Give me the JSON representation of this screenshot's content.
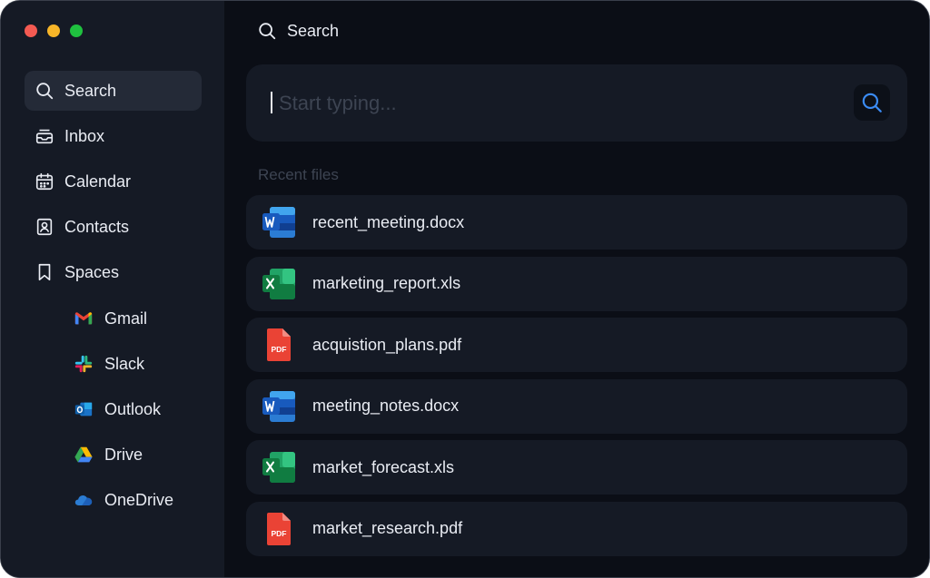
{
  "header": {
    "title": "Search"
  },
  "sidebar": {
    "nav": [
      {
        "label": "Search",
        "icon": "search-icon",
        "active": true
      },
      {
        "label": "Inbox",
        "icon": "inbox-icon"
      },
      {
        "label": "Calendar",
        "icon": "calendar-icon"
      },
      {
        "label": "Contacts",
        "icon": "contacts-icon"
      },
      {
        "label": "Spaces",
        "icon": "bookmark-icon"
      }
    ],
    "spaces": [
      {
        "label": "Gmail",
        "icon": "gmail-icon"
      },
      {
        "label": "Slack",
        "icon": "slack-icon"
      },
      {
        "label": "Outlook",
        "icon": "outlook-icon"
      },
      {
        "label": "Drive",
        "icon": "google-drive-icon"
      },
      {
        "label": "OneDrive",
        "icon": "onedrive-icon"
      }
    ]
  },
  "search": {
    "placeholder": "Start typing...",
    "value": ""
  },
  "recent": {
    "label": "Recent files",
    "files": [
      {
        "name": "recent_meeting.docx",
        "icon": "word-file-icon"
      },
      {
        "name": "marketing_report.xls",
        "icon": "excel-file-icon"
      },
      {
        "name": "acquistion_plans.pdf",
        "icon": "pdf-file-icon"
      },
      {
        "name": "meeting_notes.docx",
        "icon": "word-file-icon"
      },
      {
        "name": "market_forecast.xls",
        "icon": "excel-file-icon"
      },
      {
        "name": "market_research.pdf",
        "icon": "pdf-file-icon"
      }
    ]
  },
  "colors": {
    "background": "#0b0e16",
    "sidebar": "#151a25",
    "accent": "#3b8cf6",
    "text": "#e9ecf3",
    "muted": "#3d4452"
  }
}
